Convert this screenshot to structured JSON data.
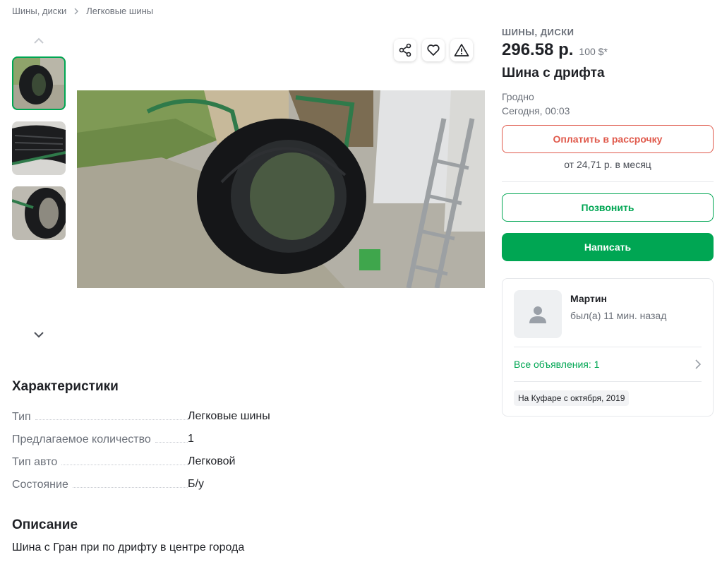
{
  "breadcrumb": {
    "items": [
      "Шины, диски",
      "Легковые шины"
    ]
  },
  "listing": {
    "category": "ШИНЫ, ДИСКИ",
    "price": "296.58 р.",
    "price_usd": "100 $*",
    "title": "Шина с дрифта",
    "city": "Гродно",
    "posted": "Сегодня, 00:03"
  },
  "buttons": {
    "installment": "Оплатить в рассрочку",
    "installment_note": "от 24,71 р. в месяц",
    "call": "Позвонить",
    "write": "Написать"
  },
  "seller": {
    "name": "Мартин",
    "status": "был(а) 11 мин. назад",
    "all_ads": "Все объявления: 1",
    "since": "На Куфаре с октября, 2019"
  },
  "characteristics": {
    "title": "Характеристики",
    "rows": [
      {
        "label": "Тип",
        "value": "Легковые шины"
      },
      {
        "label": "Предлагаемое количество",
        "value": "1"
      },
      {
        "label": "Тип авто",
        "value": "Легковой"
      },
      {
        "label": "Состояние",
        "value": "Б/у"
      }
    ]
  },
  "description": {
    "title": "Описание",
    "text": "Шина с Гран при по дрифту в центре города"
  },
  "icons": [
    "chevron-up-icon",
    "chevron-down-icon",
    "share-icon",
    "heart-icon",
    "warning-icon",
    "user-icon",
    "chevron-right-icon"
  ],
  "colors": {
    "accent": "#00a653",
    "installment": "#e05a4c",
    "muted": "#6b7079"
  }
}
